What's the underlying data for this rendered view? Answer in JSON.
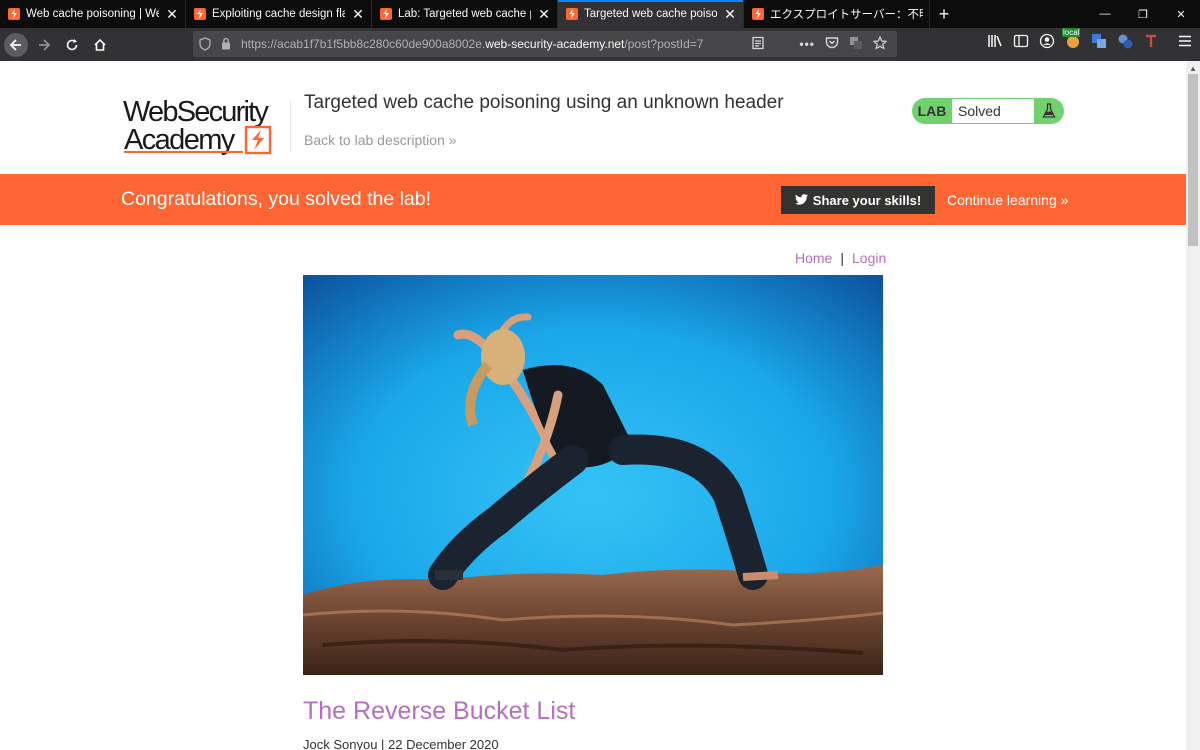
{
  "browser": {
    "tabs": [
      {
        "title": "Web cache poisoning | Web Se",
        "active": false
      },
      {
        "title": "Exploiting cache design flaws |",
        "active": false
      },
      {
        "title": "Lab: Targeted web cache poiso",
        "active": false
      },
      {
        "title": "Targeted web cache poisoning",
        "active": true
      },
      {
        "title": "エクスプロイトサーバー：不明なヘッ",
        "active": false
      }
    ],
    "url_prefix": "https://acab1f7b1f5bb8c280c60de900a8002e.",
    "url_domain": "web-security-academy.net",
    "url_path": "/post?postId=7",
    "extension_badge": "local"
  },
  "header": {
    "logo_line1": "WebSecurity",
    "logo_line2": "Academy",
    "lab_title": "Targeted web cache poisoning using an unknown header",
    "back_link": "Back to lab description",
    "back_link_chevron": "»",
    "lab_badge": "LAB",
    "lab_status": "Solved"
  },
  "banner": {
    "message": "Congratulations, you solved the lab!",
    "share_label": "Share your skills!",
    "continue_label": "Continue learning",
    "continue_chevron": "»"
  },
  "nav": {
    "home": "Home",
    "separator": "|",
    "login": "Login"
  },
  "post": {
    "title": "The Reverse Bucket List",
    "meta": "Jock Sonyou | 22 December 2020"
  },
  "colors": {
    "accent_orange": "#ff6633",
    "link_purple": "#b56ec4",
    "lab_green": "#70d16d",
    "dark": "#333332"
  }
}
